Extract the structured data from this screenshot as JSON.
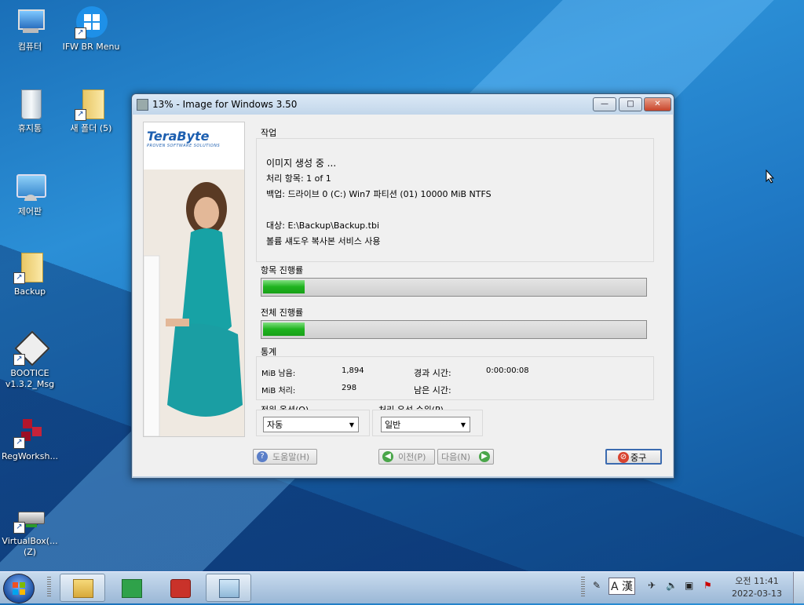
{
  "desktop": {
    "icons": [
      {
        "label": "컴퓨터"
      },
      {
        "label": "IFW BR Menu"
      },
      {
        "label": "휴지통"
      },
      {
        "label": "새 폴더 (5)"
      },
      {
        "label": "제어판"
      },
      {
        "label": "Backup"
      },
      {
        "label": "BOOTICE v1.3.2_Msg"
      },
      {
        "label": "RegWorksh..."
      },
      {
        "label": "VirtualBox(... (Z)"
      }
    ]
  },
  "window": {
    "title": "13% - Image for Windows 3.50",
    "controls": {
      "minimize": "—",
      "maximize": "□",
      "close": "✕"
    },
    "logo": {
      "name": "TeraByte",
      "tagline": "PROVEN SOFTWARE SOLUTIONS"
    },
    "task": {
      "label": "작업",
      "line1": "이미지 생성 중 ...",
      "line2": "처리 항목: 1 of 1",
      "line3": "백업: 드라이브 0 (C:) Win7 파티션 (01) 10000 MiB NTFS",
      "line4": "대상: E:\\Backup\\Backup.tbi",
      "line5": "볼륨 섀도우 복사본 서비스 사용"
    },
    "item_progress": {
      "label": "항목 진행률",
      "value": 0.11
    },
    "total_progress": {
      "label": "전체 진행률",
      "value": 0.11
    },
    "stats": {
      "label": "통계",
      "mib_remaining_label": "MiB 남음:",
      "mib_remaining": "1,894",
      "mib_processed_label": "MiB 처리:",
      "mib_processed": "298",
      "elapsed_label": "경과 시간:",
      "elapsed": "0:00:00:08",
      "remaining_label": "남은 시간:",
      "remaining": ""
    },
    "power": {
      "label": "전원 옵션(O)",
      "value": "자동"
    },
    "priority": {
      "label": "처리 우선 순위(P)",
      "value": "일반"
    },
    "buttons": {
      "help": "도움말(H)",
      "back": "이전(P)",
      "next": "다음(N)",
      "exit": "중구"
    }
  },
  "taskbar": {
    "ime": "A 漢",
    "clock_period": "오전 11:41",
    "clock_date": "2022-03-13"
  },
  "colors": {
    "progress_green": "#1fb31f",
    "exit_icon": "#d8432f",
    "nav_icon": "#4aa64a",
    "help_icon": "#5a7ec8"
  }
}
